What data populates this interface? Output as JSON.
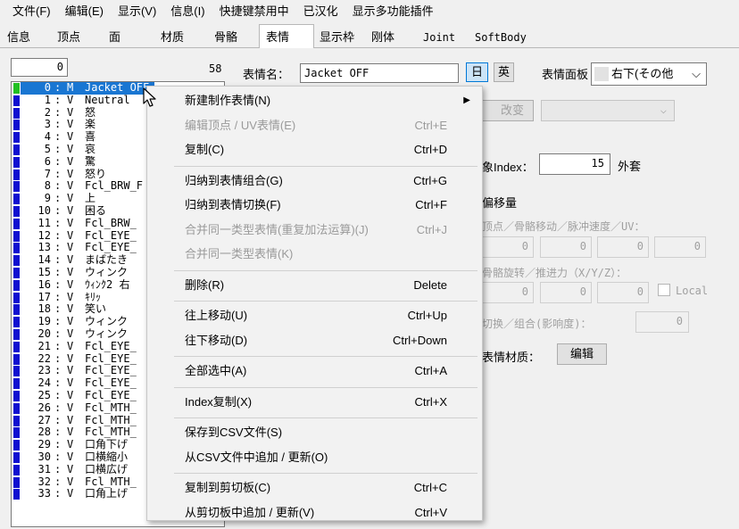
{
  "menubar": [
    "文件(F)",
    "编辑(E)",
    "显示(V)",
    "信息(I)",
    "快捷键禁用中",
    "已汉化",
    "显示多功能插件"
  ],
  "tabs": [
    {
      "label": "信息",
      "active": false
    },
    {
      "label": "顶点",
      "active": false
    },
    {
      "label": "面",
      "active": false
    },
    {
      "label": "材质",
      "active": false
    },
    {
      "label": "骨骼",
      "active": false
    },
    {
      "label": "表情",
      "active": true
    },
    {
      "label": "显示枠",
      "active": false
    },
    {
      "label": "刚体",
      "active": false
    },
    {
      "label": "Joint",
      "active": false
    },
    {
      "label": "SoftBody",
      "active": false
    }
  ],
  "list_header": {
    "input_value": "0",
    "count": "58"
  },
  "morph_list": [
    {
      "idx": "0",
      "type": "M",
      "name": "Jacket OFF",
      "selected": true,
      "green": true
    },
    {
      "idx": "1",
      "type": "V",
      "name": "Neutral"
    },
    {
      "idx": "2",
      "type": "V",
      "name": "怒"
    },
    {
      "idx": "3",
      "type": "V",
      "name": "楽"
    },
    {
      "idx": "4",
      "type": "V",
      "name": "喜"
    },
    {
      "idx": "5",
      "type": "V",
      "name": "哀"
    },
    {
      "idx": "6",
      "type": "V",
      "name": "驚"
    },
    {
      "idx": "7",
      "type": "V",
      "name": "怒り"
    },
    {
      "idx": "8",
      "type": "V",
      "name": "Fcl_BRW_F"
    },
    {
      "idx": "9",
      "type": "V",
      "name": "上"
    },
    {
      "idx": "10",
      "type": "V",
      "name": "困る"
    },
    {
      "idx": "11",
      "type": "V",
      "name": "Fcl_BRW_"
    },
    {
      "idx": "12",
      "type": "V",
      "name": "Fcl_EYE_"
    },
    {
      "idx": "13",
      "type": "V",
      "name": "Fcl_EYE_"
    },
    {
      "idx": "14",
      "type": "V",
      "name": "まばたき"
    },
    {
      "idx": "15",
      "type": "V",
      "name": "ウィンク"
    },
    {
      "idx": "16",
      "type": "V",
      "name": "ｳｨﾝｸ2 右"
    },
    {
      "idx": "17",
      "type": "V",
      "name": "ｷﾘｯ"
    },
    {
      "idx": "18",
      "type": "V",
      "name": "笑い"
    },
    {
      "idx": "19",
      "type": "V",
      "name": "ウィンク"
    },
    {
      "idx": "20",
      "type": "V",
      "name": "ウィンク"
    },
    {
      "idx": "21",
      "type": "V",
      "name": "Fcl_EYE_"
    },
    {
      "idx": "22",
      "type": "V",
      "name": "Fcl_EYE_"
    },
    {
      "idx": "23",
      "type": "V",
      "name": "Fcl_EYE_"
    },
    {
      "idx": "24",
      "type": "V",
      "name": "Fcl_EYE_"
    },
    {
      "idx": "25",
      "type": "V",
      "name": "Fcl_EYE_"
    },
    {
      "idx": "26",
      "type": "V",
      "name": "Fcl_MTH_"
    },
    {
      "idx": "27",
      "type": "V",
      "name": "Fcl_MTH_"
    },
    {
      "idx": "28",
      "type": "V",
      "name": "Fcl_MTH_"
    },
    {
      "idx": "29",
      "type": "V",
      "name": "口角下げ"
    },
    {
      "idx": "30",
      "type": "V",
      "name": "口横縮小"
    },
    {
      "idx": "31",
      "type": "V",
      "name": "口横広げ"
    },
    {
      "idx": "32",
      "type": "V",
      "name": "Fcl_MTH_"
    },
    {
      "idx": "33",
      "type": "V",
      "name": "口角上げ"
    }
  ],
  "right": {
    "name_label": "表情名：",
    "name_value": "Jacket OFF",
    "lang_jp": "日",
    "lang_en": "英",
    "panel_label": "表情面板",
    "panel_value": "右下(その他",
    "modify_button": "改变",
    "index_label": "象Index：",
    "index_value": "15",
    "outer_label": "外套",
    "offset_title": "偏移量",
    "vertex_label": "顶点／骨骼移动／脉冲速度／UV：",
    "vertex_values": [
      "0",
      "0",
      "0",
      "0"
    ],
    "bone_label": "骨骼旋转／推进力（X/Y/Z）：",
    "bone_values": [
      "0",
      "0",
      "0"
    ],
    "local_label": "Local",
    "switch_label": "切换／组合(影响度)：",
    "switch_value": "0",
    "material_label": "表情材质：",
    "edit_button": "编辑"
  },
  "context_menu": [
    {
      "label": "新建制作表情(N)",
      "shortcut": "",
      "submenu": true,
      "disabled": false
    },
    {
      "label": "编辑顶点 / UV表情(E)",
      "shortcut": "Ctrl+E",
      "disabled": true
    },
    {
      "label": "复制(C)",
      "shortcut": "Ctrl+D",
      "disabled": false
    },
    {
      "sep": true
    },
    {
      "label": "归纳到表情组合(G)",
      "shortcut": "Ctrl+G",
      "disabled": false
    },
    {
      "label": "归纳到表情切换(F)",
      "shortcut": "Ctrl+F",
      "disabled": false
    },
    {
      "label": "合并同一类型表情(重复加法运算)(J)",
      "shortcut": "Ctrl+J",
      "disabled": true
    },
    {
      "label": "合并同一类型表情(K)",
      "shortcut": "",
      "disabled": true
    },
    {
      "sep": true
    },
    {
      "label": "删除(R)",
      "shortcut": "Delete",
      "disabled": false
    },
    {
      "sep": true
    },
    {
      "label": "往上移动(U)",
      "shortcut": "Ctrl+Up",
      "disabled": false
    },
    {
      "label": "往下移动(D)",
      "shortcut": "Ctrl+Down",
      "disabled": false
    },
    {
      "sep": true
    },
    {
      "label": "全部选中(A)",
      "shortcut": "Ctrl+A",
      "disabled": false
    },
    {
      "sep": true
    },
    {
      "label": "Index复制(X)",
      "shortcut": "Ctrl+X",
      "disabled": false
    },
    {
      "sep": true
    },
    {
      "label": "保存到CSV文件(S)",
      "shortcut": "",
      "disabled": false
    },
    {
      "label": "从CSV文件中追加 / 更新(O)",
      "shortcut": "",
      "disabled": false
    },
    {
      "sep": true
    },
    {
      "label": "复制到剪切板(C)",
      "shortcut": "Ctrl+C",
      "disabled": false
    },
    {
      "label": "从剪切板中追加 / 更新(V)",
      "shortcut": "Ctrl+V",
      "disabled": false
    }
  ]
}
